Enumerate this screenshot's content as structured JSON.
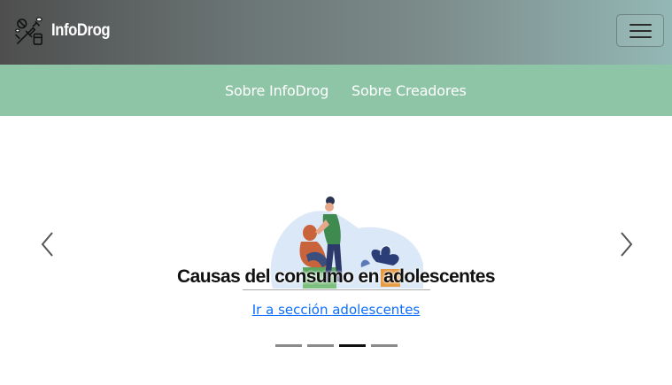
{
  "navbar": {
    "brand": "InfoDrog",
    "logo_icon": "drugs-logo-icon",
    "toggler_icon": "hamburger-menu-icon"
  },
  "subnav": {
    "items": [
      {
        "label": "Sobre InfoDrog"
      },
      {
        "label": "Sobre Creadores"
      }
    ]
  },
  "carousel": {
    "prev_icon": "chevron-left-icon",
    "next_icon": "chevron-right-icon",
    "slide": {
      "caption": "Causas del consumo en adolescentes",
      "link": "Ir a sección adolescentes"
    },
    "indicator_count": 4,
    "active_indicator": 3
  },
  "colors": {
    "subnav_bg": "#8fc5a7",
    "link": "#0d6efd"
  }
}
